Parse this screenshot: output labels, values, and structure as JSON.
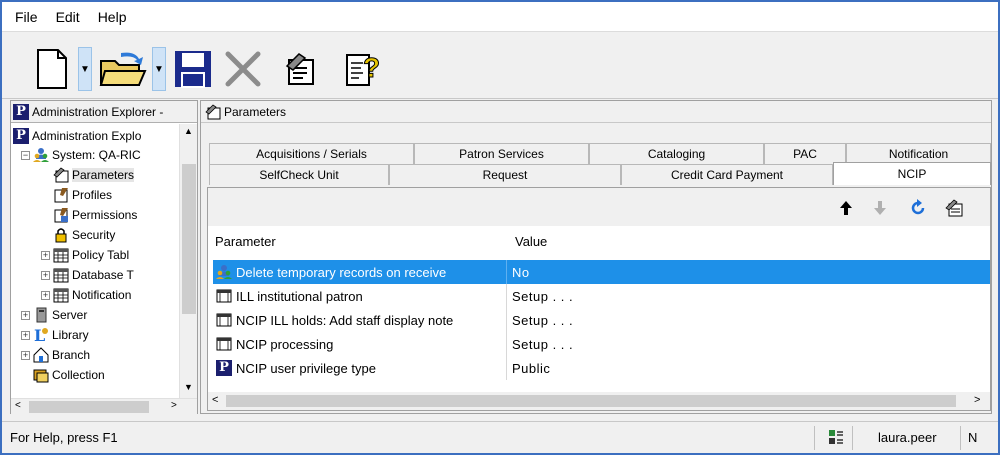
{
  "menu": {
    "file": "File",
    "edit": "Edit",
    "help": "Help"
  },
  "toolbar": {
    "icons": [
      "new-document-icon",
      "open-folder-icon",
      "save-icon",
      "delete-icon",
      "properties-icon",
      "help-icon"
    ]
  },
  "explorer": {
    "header": "Administration Explorer -",
    "tree": [
      {
        "label": "Administration Explo"
      },
      {
        "label": "System: QA-RIC"
      },
      {
        "label": "Parameters"
      },
      {
        "label": "Profiles"
      },
      {
        "label": "Permissions"
      },
      {
        "label": "Security"
      },
      {
        "label": "Policy Tabl"
      },
      {
        "label": "Database T"
      },
      {
        "label": "Notification"
      },
      {
        "label": "Server"
      },
      {
        "label": "Library"
      },
      {
        "label": "Branch"
      },
      {
        "label": "Collection"
      }
    ]
  },
  "panel": {
    "title": "Parameters",
    "tabs_row1": [
      "Acquisitions / Serials",
      "Patron Services",
      "Cataloging",
      "PAC",
      "Notification"
    ],
    "tabs_row2": [
      "SelfCheck Unit",
      "Request",
      "Credit Card Payment",
      "NCIP"
    ],
    "active_tab": "NCIP",
    "grid": {
      "col_parameter": "Parameter",
      "col_value": "Value",
      "rows": [
        {
          "name": "Delete temporary records on receive",
          "value": "No",
          "icon": "users-icon"
        },
        {
          "name": "ILL institutional patron",
          "value": "Setup . . .",
          "icon": "table-icon"
        },
        {
          "name": "NCIP ILL holds: Add staff display note",
          "value": "Setup . . .",
          "icon": "table-icon"
        },
        {
          "name": "NCIP processing",
          "value": "Setup . . .",
          "icon": "table-icon"
        },
        {
          "name": "NCIP user privilege type",
          "value": "Public",
          "icon": "polaris-icon"
        }
      ]
    }
  },
  "status": {
    "help": "For Help, press F1",
    "user": "laura.peer",
    "extra": "N"
  },
  "colors": {
    "selection": "#1e90e8",
    "window_border": "#3c6fc0"
  }
}
